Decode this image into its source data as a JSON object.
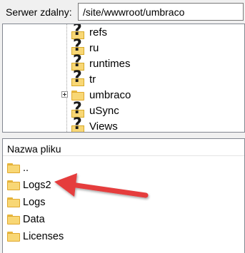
{
  "remote": {
    "label": "Serwer zdalny:",
    "path": "/site/wwwroot/umbraco"
  },
  "tree": {
    "items": [
      {
        "label": "refs",
        "icon": "question-folder-icon"
      },
      {
        "label": "ru",
        "icon": "question-folder-icon"
      },
      {
        "label": "runtimes",
        "icon": "question-folder-icon"
      },
      {
        "label": "tr",
        "icon": "question-folder-icon"
      },
      {
        "label": "umbraco",
        "icon": "folder-icon"
      },
      {
        "label": "uSync",
        "icon": "question-folder-icon"
      },
      {
        "label": "Views",
        "icon": "question-folder-icon"
      }
    ]
  },
  "files": {
    "column_header": "Nazwa pliku",
    "rows": [
      {
        "label": "..",
        "icon": "folder-icon"
      },
      {
        "label": "Logs2",
        "icon": "folder-icon"
      },
      {
        "label": "Logs",
        "icon": "folder-icon"
      },
      {
        "label": "Data",
        "icon": "folder-icon"
      },
      {
        "label": "Licenses",
        "icon": "folder-icon"
      }
    ]
  },
  "colors": {
    "folder": "#f8d775",
    "arrow": "#e53c3c"
  }
}
